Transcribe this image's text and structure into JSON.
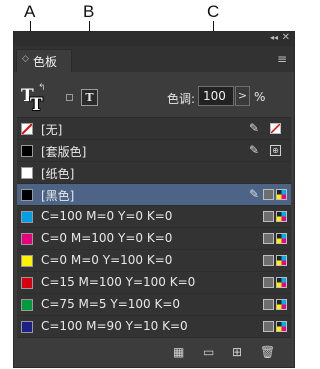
{
  "callouts": {
    "a": "A",
    "b": "B",
    "c": "C"
  },
  "panel": {
    "collapse_glyph": "◂◂",
    "close_glyph": "✕",
    "tab_arrow_glyph": "◇",
    "tab_label": "色板",
    "menu_glyph": "≡"
  },
  "controls": {
    "fill_glyph": "T",
    "stroke_glyph": "T",
    "swap_glyph": "↰",
    "text_icon_glyph": "T",
    "tint_label": "色调:",
    "tint_value": "100",
    "tint_arrow_glyph": ">",
    "tint_unit": "%"
  },
  "swatches": [
    {
      "label": "[无]",
      "color": "none",
      "noedit": true,
      "icon": "none"
    },
    {
      "label": "[套版色]",
      "color": "#000000",
      "noedit": true,
      "icon": "registration"
    },
    {
      "label": "[纸色]",
      "color": "#ffffff",
      "noedit": false,
      "icon": ""
    },
    {
      "label": "[黑色]",
      "color": "#000000",
      "noedit": true,
      "icon": "process"
    },
    {
      "label": "C=100 M=0 Y=0 K=0",
      "color": "#00a0e9",
      "noedit": false,
      "icon": "process"
    },
    {
      "label": "C=0 M=100 Y=0 K=0",
      "color": "#e4007f",
      "noedit": false,
      "icon": "process"
    },
    {
      "label": "C=0 M=0 Y=100 K=0",
      "color": "#fff100",
      "noedit": false,
      "icon": "process"
    },
    {
      "label": "C=15 M=100 Y=100 K=0",
      "color": "#d7000f",
      "noedit": false,
      "icon": "process"
    },
    {
      "label": "C=75 M=5 Y=100 K=0",
      "color": "#009a3e",
      "noedit": false,
      "icon": "process"
    },
    {
      "label": "C=100 M=90 Y=10 K=0",
      "color": "#1d2088",
      "noedit": false,
      "icon": "process"
    }
  ],
  "icons": {
    "noedit_glyph": "✎",
    "registration_glyph": "⊕"
  },
  "bottom_bar": {
    "show_all_glyph": "▦",
    "new_group_glyph": "▭",
    "new_swatch_glyph": "⊞",
    "delete_glyph": "🗑"
  },
  "colors": {
    "selected_row": "#4d6486",
    "panel_bg": "#3c3c3c"
  }
}
